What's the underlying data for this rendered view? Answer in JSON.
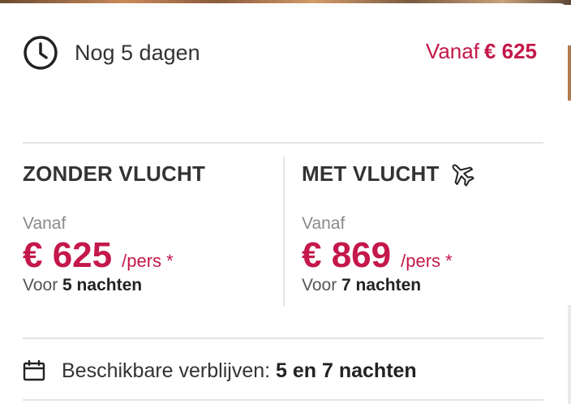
{
  "colors": {
    "accent": "#c4174a",
    "text": "#333333",
    "muted": "#8a8a8a",
    "divider": "#e3e3e3"
  },
  "header": {
    "countdown_icon": "clock-icon",
    "countdown_label": "Nog 5 dagen",
    "price_prefix": "Vanaf",
    "price_amount": "€ 625"
  },
  "options": {
    "without_flight": {
      "title": "ZONDER VLUCHT",
      "from_label": "Vanaf",
      "price": "€ 625",
      "per_person": "/pers *",
      "nights_prefix": "Voor",
      "nights": "5 nachten"
    },
    "with_flight": {
      "title": "MET VLUCHT",
      "title_icon": "airplane-icon",
      "from_label": "Vanaf",
      "price": "€ 869",
      "per_person": "/pers *",
      "nights_prefix": "Voor",
      "nights": "7 nachten"
    }
  },
  "availability": {
    "icon": "calendar-icon",
    "label": "Beschikbare verblijven:",
    "value": "5 en 7 nachten"
  }
}
